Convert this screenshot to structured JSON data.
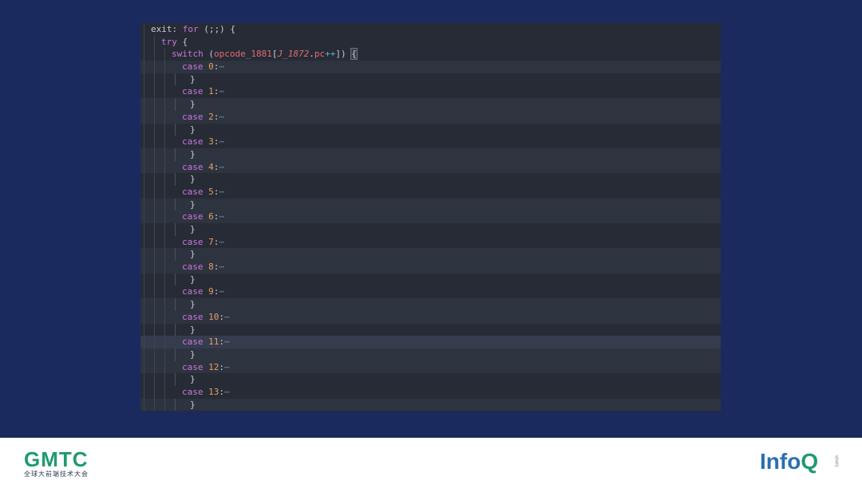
{
  "code": {
    "line_exit": {
      "label": "exit:",
      "kw_for": "for",
      "rest": " (;;) {"
    },
    "line_try": {
      "kw": "try",
      "rest": " {"
    },
    "line_switch": {
      "kw": "switch",
      "open": " (",
      "var": "opcode_1881",
      "bracket_open": "[",
      "ital": "J_1872",
      "dot": ".",
      "prop": "pc",
      "op": "++",
      "close": "])",
      "brace": "{"
    },
    "case_keyword": "case",
    "fold_marker": "⋯",
    "close_brace": "}",
    "cases": [
      "0",
      "1",
      "2",
      "3",
      "4",
      "5",
      "6",
      "7",
      "8",
      "9",
      "10",
      "11",
      "12",
      "13"
    ],
    "highlighted_case": "11"
  },
  "footer": {
    "gmtc_word": "GMTC",
    "gmtc_sub": "全球大前端技术大会",
    "infoq_info": "Info",
    "infoq_q": "Q",
    "infoq_tag": "极客邦"
  }
}
